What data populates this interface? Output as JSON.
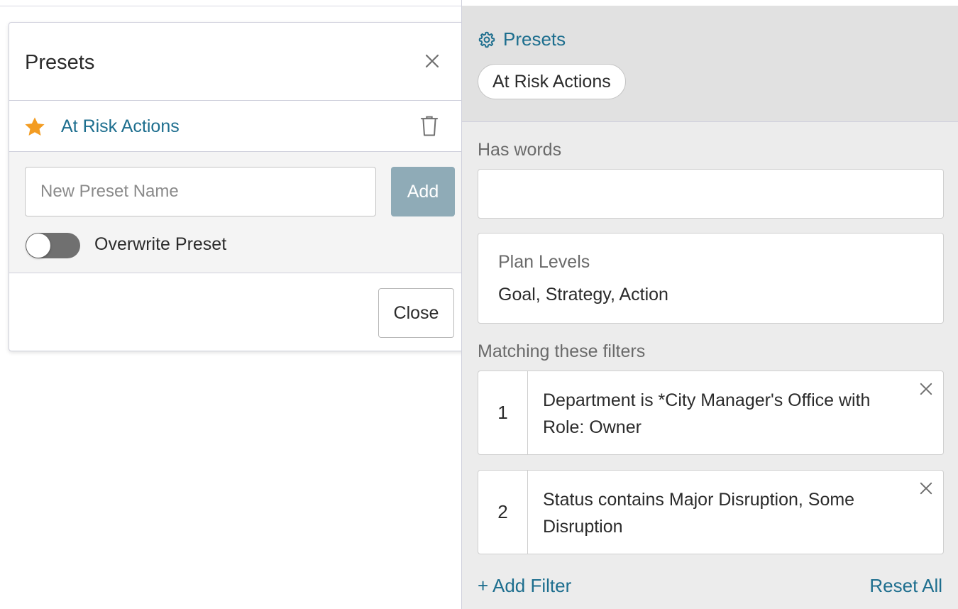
{
  "modal": {
    "title": "Presets",
    "close_icon": "close-icon",
    "preset_items": [
      {
        "name": "At Risk Actions",
        "icon": "star-icon",
        "delete_icon": "trash-icon"
      }
    ],
    "new_preset": {
      "placeholder": "New Preset Name",
      "value": ""
    },
    "add_label": "Add",
    "overwrite_label": "Overwrite Preset",
    "overwrite_enabled": false,
    "close_label": "Close"
  },
  "filters_panel": {
    "presets_link": "Presets",
    "presets_icon": "gear-icon",
    "active_preset": "At Risk Actions",
    "has_words_label": "Has words",
    "has_words_value": "",
    "plan_levels": {
      "title": "Plan Levels",
      "value": "Goal, Strategy, Action"
    },
    "matching_label": "Matching these filters",
    "filters": [
      {
        "number": "1",
        "text": "Department is *City Manager's Office with Role: Owner"
      },
      {
        "number": "2",
        "text": "Status contains Major Disruption, Some Disruption"
      }
    ],
    "add_filter": "+ Add Filter",
    "reset_all": "Reset All"
  },
  "colors": {
    "link": "#1d6e8e",
    "star": "#f39c22",
    "add_button": "#8fabb7",
    "toggle_off": "#707070",
    "panel_bg": "#ececec",
    "presets_band_bg": "#e1e1e1"
  }
}
